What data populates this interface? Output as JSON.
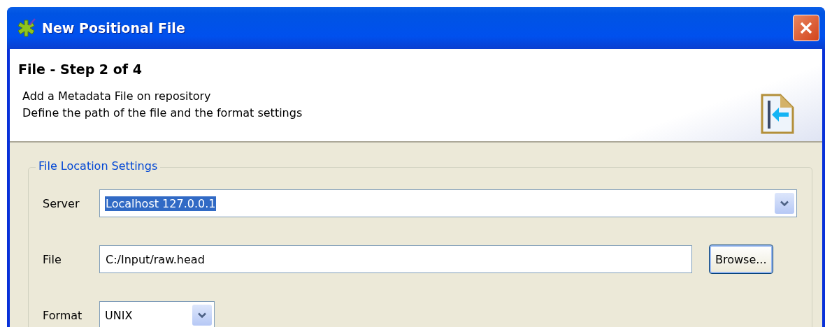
{
  "window": {
    "title": "New Positional File"
  },
  "header": {
    "title": "File - Step 2 of 4",
    "lines": [
      "Add a Metadata File on repository",
      "Define the path of the file and the format settings"
    ]
  },
  "group": {
    "title": "File Location Settings",
    "rows": [
      {
        "kind": "combo",
        "label": "Server",
        "value": "Localhost 127.0.0.1",
        "text_selected": true,
        "wide": true
      },
      {
        "kind": "text",
        "label": "File",
        "value": "C:/Input/raw.head",
        "button": {
          "label": "Browse...",
          "focused": true
        }
      },
      {
        "kind": "combo",
        "label": "Format",
        "value": "UNIX",
        "text_selected": false,
        "wide": false
      }
    ]
  }
}
